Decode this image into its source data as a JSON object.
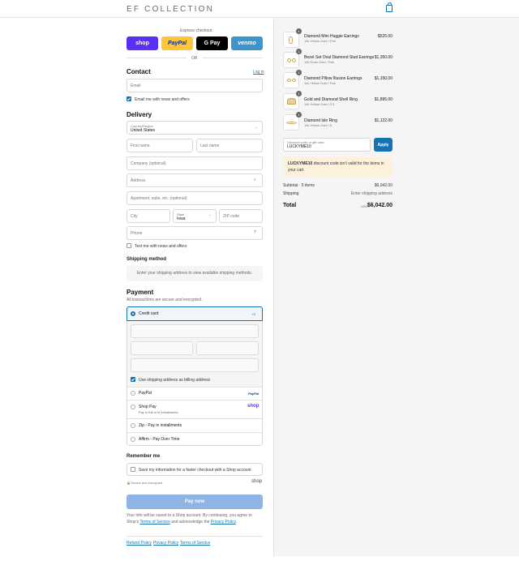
{
  "header": {
    "logo": "EF COLLECTION",
    "cart_icon": "shopping-bag-icon"
  },
  "express": {
    "title": "Express checkout",
    "buttons": [
      {
        "label": "shop",
        "color": "#5a31f4"
      },
      {
        "label": "PayPal",
        "color": "#ffc439"
      },
      {
        "label": "G Pay",
        "color": "#000000"
      },
      {
        "label": "venmo",
        "color": "#3d95ce"
      }
    ],
    "or": "OR"
  },
  "contact": {
    "title": "Contact",
    "login": "Log in",
    "email_placeholder": "Email",
    "news_label": "Email me with news and offers"
  },
  "delivery": {
    "title": "Delivery",
    "country_label": "Country/Region",
    "country_value": "United States",
    "first_name": "First name",
    "last_name": "Last name",
    "company": "Company (optional)",
    "address": "Address",
    "apartment": "Apartment, suite, etc. (optional)",
    "city": "City",
    "state_label": "State",
    "state_value": "Iowa",
    "zip": "ZIP code",
    "phone": "Phone",
    "sms_label": "Text me with news and offers"
  },
  "shipping": {
    "title": "Shipping method",
    "message": "Enter your shipping address to view available shipping methods."
  },
  "payment": {
    "title": "Payment",
    "subtitle": "All transactions are secure and encrypted.",
    "credit_card": "Credit card",
    "card_badge": "+3",
    "billing_label": "Use shipping address as billing address",
    "paypal": "PayPal",
    "paypal_logo": "PayPal",
    "shop_pay": "Shop Pay",
    "shop_pay_sub": "Pay in full or in installments",
    "shop_logo": "shop",
    "zip": "Zip - Pay in installments",
    "affirm": "Affirm - Pay Over Time"
  },
  "remember": {
    "title": "Remember me",
    "label": "Save my information for a faster checkout with a Shop account",
    "secure": "Secure and encrypted",
    "shop_logo": "shop"
  },
  "pay_button": "Pay now",
  "disclaimer": {
    "text1": "Your info will be saved to a Shop account. By continuing, you agree to Shop’s",
    "terms": "Terms of Service",
    "text2": "and acknowledge the",
    "privacy": "Privacy Policy",
    "end": "."
  },
  "footer": {
    "links": [
      "Refund Policy",
      "Privacy Policy",
      "Terms of Service"
    ]
  },
  "cart": {
    "items": [
      {
        "name": "Diamond Mini Huggie Earrings",
        "variant": "14k Yellow Gold / Pair",
        "price": "$525.00",
        "qty": "1"
      },
      {
        "name": "Bezel Set Oval Diamond Stud Earrings",
        "variant": "14k Rose Gold / Pair",
        "price": "$1,350.00",
        "qty": "1"
      },
      {
        "name": "Diamond Pillow Illusion Earrings",
        "variant": "14k Yellow Gold / Pair",
        "price": "$1,150.00",
        "qty": "1"
      },
      {
        "name": "Gold and Diamond Shell Ring",
        "variant": "14k Yellow Gold / 3.5",
        "price": "$1,895.00",
        "qty": "1"
      },
      {
        "name": "Diamond Isle Ring",
        "variant": "14k Yellow Gold / 5",
        "price": "$1,122.00",
        "qty": "1"
      }
    ],
    "discount_label": "Discount code or gift card",
    "discount_value": "LUCKYME10",
    "apply": "Apply",
    "error_code": "LUCKYME10",
    "error_text": "discount code isn’t valid for the items in your cart",
    "subtotal_label": "Subtotal · 5 items",
    "subtotal_value": "$6,042.00",
    "shipping_label": "Shipping",
    "shipping_value": "Enter shipping address",
    "total_label": "Total",
    "currency": "USD",
    "total_value": "$6,042.00"
  }
}
